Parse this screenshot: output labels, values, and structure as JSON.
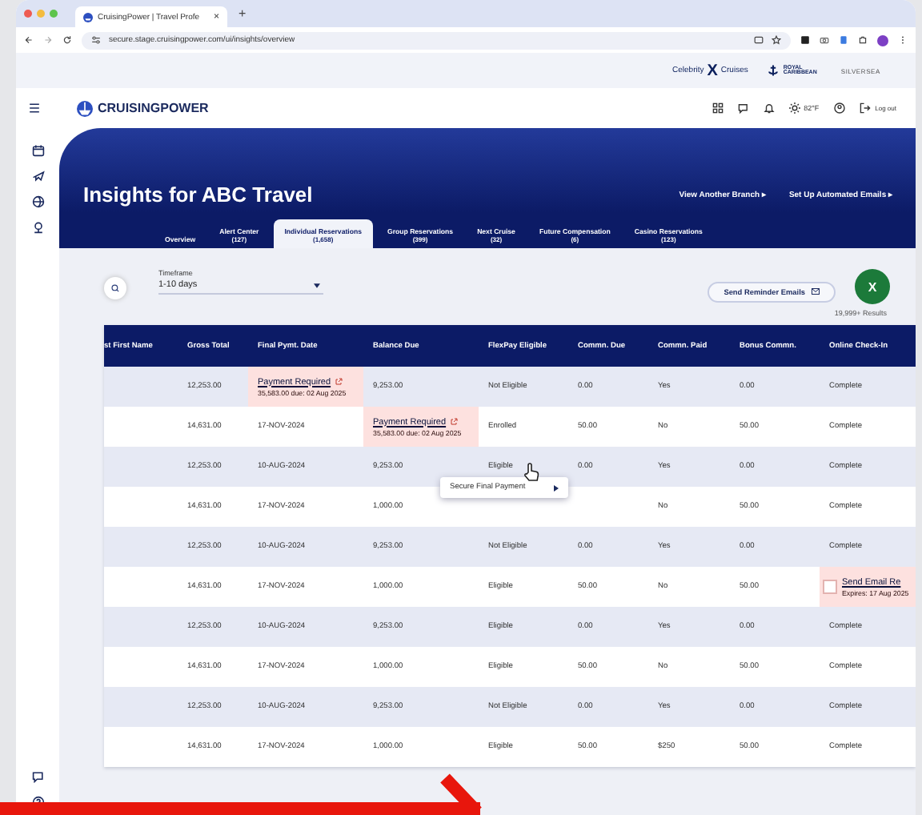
{
  "browser": {
    "tab_title": "CruisingPower | Travel Profe",
    "tab_close": "×",
    "new_tab": "+",
    "url": "secure.stage.cruisingpower.com/ui/insights/overview"
  },
  "brands": [
    "Celebrity",
    "X",
    "Cruises",
    "ROYAL CARIBBEAN",
    "SILVERSEA"
  ],
  "header": {
    "logo": "CRUISINGPOWER",
    "weather": "82°F",
    "logout": "Log out"
  },
  "page": {
    "title": "Insights for ABC Travel",
    "links": [
      {
        "label": "View Another Branch",
        "arrow": "▸"
      },
      {
        "label": "Set Up Automated Emails",
        "arrow": "▸"
      }
    ]
  },
  "tabs": [
    {
      "label": "Overview",
      "selected": false
    },
    {
      "label": "Alert Center",
      "count": "(127)",
      "selected": false
    },
    {
      "label": "Individual Reservations",
      "count": "(1,658)",
      "selected": true
    },
    {
      "label": "Group Reservations",
      "count": "(399)",
      "selected": false
    },
    {
      "label": "Next Cruise",
      "count": "(32)",
      "selected": false
    },
    {
      "label": "Future Compensation",
      "count": "(6)",
      "selected": false
    },
    {
      "label": "Casino Reservations",
      "count": "(123)",
      "selected": false
    }
  ],
  "filters": {
    "timeframe_label": "Timeframe",
    "timeframe_value": "1-10 days",
    "send_button": "Send Reminder Emails",
    "export_button": "X",
    "results": "19,999+ Results"
  },
  "table": {
    "columns": [
      "st First Name",
      "Gross Total",
      "Final Pymt. Date",
      "Balance Due",
      "FlexPay Eligible",
      "Commn. Due",
      "Commn. Paid",
      "Bonus Commn.",
      "Online Check-In"
    ],
    "rows": [
      {
        "cells": [
          "",
          "12,253.00",
          {
            "kind": "alert",
            "link": "Payment Required",
            "note": "35,583.00 due: 02 Aug 2025"
          },
          "9,253.00",
          "Not Eligible",
          "0.00",
          "Yes",
          "0.00",
          "Complete"
        ]
      },
      {
        "cells": [
          "",
          "14,631.00",
          "17-NOV-2024",
          {
            "kind": "alert",
            "link": "Payment Required",
            "note": "35,583.00 due: 02 Aug 2025"
          },
          "Enrolled",
          "50.00",
          "No",
          "50.00",
          "Complete"
        ]
      },
      {
        "cells": [
          "",
          "12,253.00",
          "10-AUG-2024",
          "9,253.00",
          "Eligible",
          "0.00",
          "Yes",
          "0.00",
          "Complete"
        ]
      },
      {
        "cells": [
          "",
          "14,631.00",
          "17-NOV-2024",
          "1,000.00",
          null,
          null,
          "No",
          "50.00",
          "Complete"
        ]
      },
      {
        "cells": [
          "",
          "12,253.00",
          "10-AUG-2024",
          "9,253.00",
          "Not Eligible",
          "0.00",
          "Yes",
          "0.00",
          "Complete"
        ]
      },
      {
        "cells": [
          "",
          "14,631.00",
          "17-NOV-2024",
          "1,000.00",
          "Eligible",
          "50.00",
          "No",
          "50.00",
          {
            "kind": "email",
            "link": "Send Email Re",
            "note": "Expires: 17 Aug 2025",
            "checked": false
          }
        ]
      },
      {
        "cells": [
          "",
          "12,253.00",
          "10-AUG-2024",
          "9,253.00",
          "Eligible",
          "0.00",
          "Yes",
          "0.00",
          "Complete"
        ]
      },
      {
        "cells": [
          "",
          "14,631.00",
          "17-NOV-2024",
          "1,000.00",
          "Eligible",
          "50.00",
          "No",
          "50.00",
          "Complete"
        ]
      },
      {
        "cells": [
          "",
          "12,253.00",
          "10-AUG-2024",
          "9,253.00",
          "Not Eligible",
          "0.00",
          "Yes",
          "0.00",
          "Complete"
        ]
      },
      {
        "cells": [
          "",
          "14,631.00",
          "17-NOV-2024",
          "1,000.00",
          "Eligible",
          "50.00",
          "$250",
          "50.00",
          "Complete"
        ]
      }
    ]
  },
  "context_menu": {
    "item": "Secure Final Payment"
  }
}
